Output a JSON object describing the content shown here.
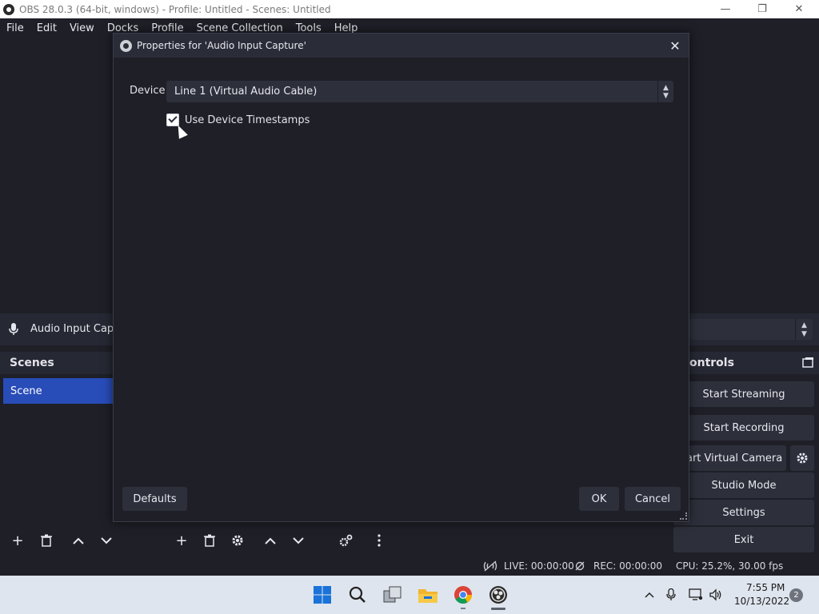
{
  "window": {
    "title": "OBS 28.0.3 (64-bit, windows) - Profile: Untitled - Scenes: Untitled",
    "controls": {
      "minimize": "—",
      "maximize": "❐",
      "close": "✕"
    }
  },
  "menu": {
    "items": [
      "File",
      "Edit",
      "View",
      "Docks",
      "Profile",
      "Scene Collection",
      "Tools",
      "Help"
    ]
  },
  "source_bar": {
    "source_name": "Audio Input Capt",
    "icon": "microphone-icon"
  },
  "scenes": {
    "header": "Scenes",
    "items": [
      "Scene"
    ]
  },
  "controls": {
    "header": "ontrols",
    "buttons": {
      "start_streaming": "Start Streaming",
      "start_recording": "Start Recording",
      "virtual_camera": "art Virtual Camera",
      "studio_mode": "Studio Mode",
      "settings": "Settings",
      "exit": "Exit"
    }
  },
  "status": {
    "live": "LIVE: 00:00:00",
    "rec": "REC: 00:00:00",
    "cpu": "CPU: 25.2%, 30.00 fps"
  },
  "dialog": {
    "title": "Properties for 'Audio Input Capture'",
    "device_label": "Device",
    "device_value": "Line 1 (Virtual Audio Cable)",
    "use_timestamps_label": "Use Device Timestamps",
    "use_timestamps_checked": true,
    "defaults_button": "Defaults",
    "ok_button": "OK",
    "cancel_button": "Cancel"
  },
  "taskbar": {
    "time": "7:55 PM",
    "date": "10/13/2022",
    "notification_count": "2",
    "icons": [
      "windows-start-icon",
      "search-icon",
      "task-view-icon",
      "file-explorer-icon",
      "chrome-icon",
      "obs-icon"
    ]
  },
  "colors": {
    "background": "#1e1f27",
    "panel": "#262834",
    "selected_scene": "#284cb8",
    "button": "#2d2f3b"
  }
}
